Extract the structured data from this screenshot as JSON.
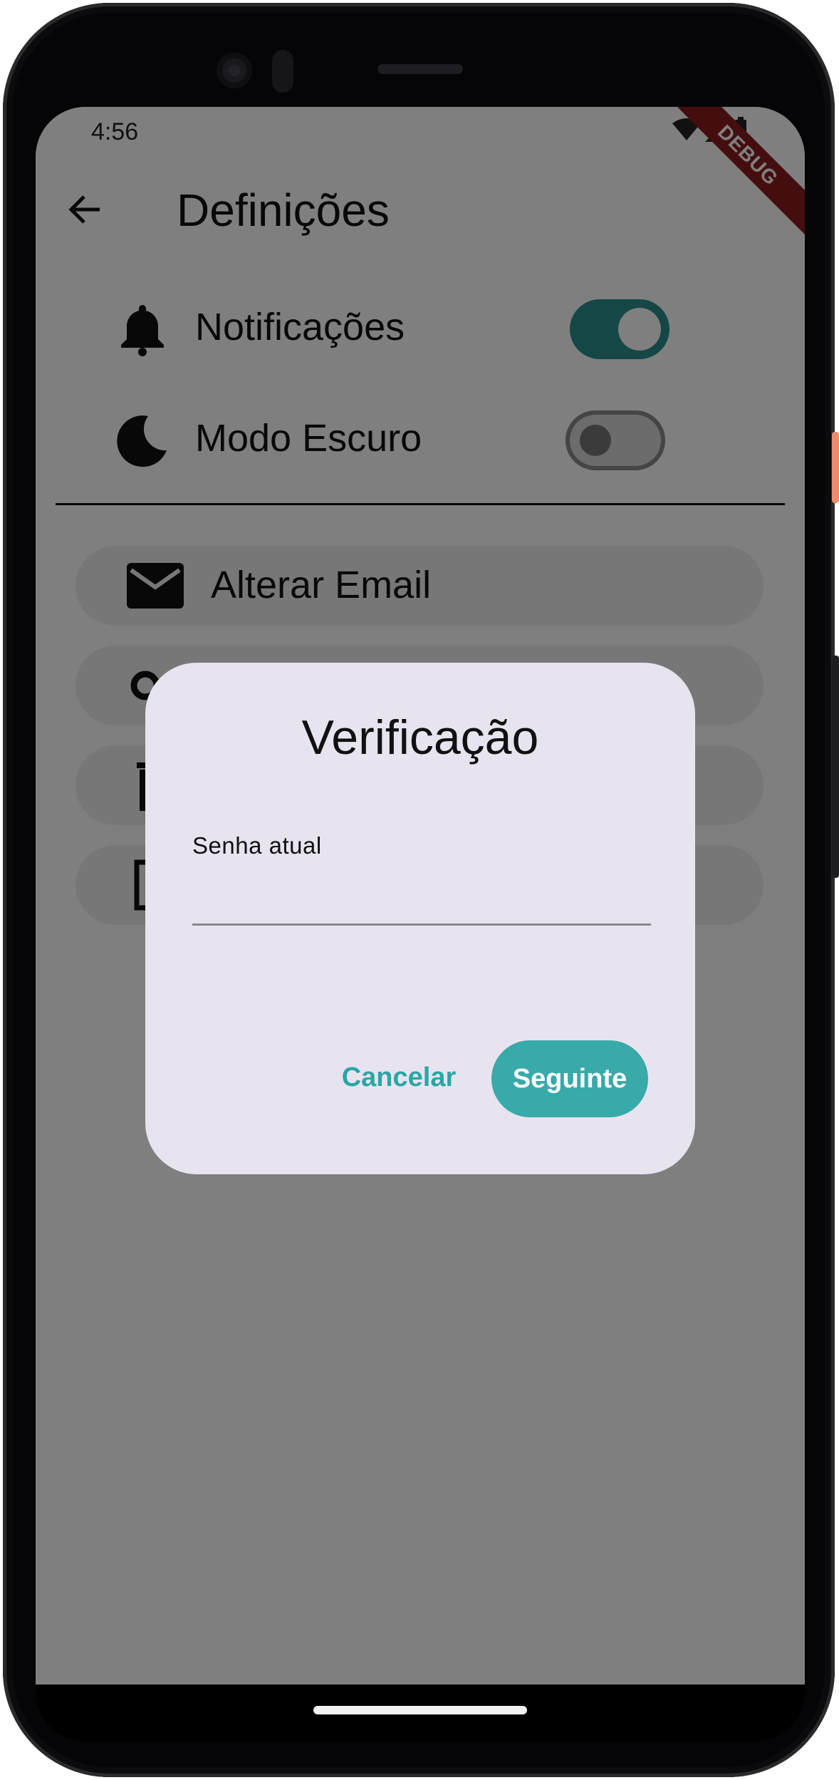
{
  "status_bar": {
    "time": "4:56"
  },
  "debug_banner": "DEBUG",
  "app_bar": {
    "title": "Definições"
  },
  "toggles": [
    {
      "label": "Notificações",
      "icon": "bell-icon",
      "on": true
    },
    {
      "label": "Modo Escuro",
      "icon": "moon-icon",
      "on": false
    }
  ],
  "actions": [
    {
      "label": "Alterar Email",
      "icon": "mail-icon"
    },
    {
      "label": "",
      "icon": "key-icon"
    },
    {
      "label": "",
      "icon": "trash-icon"
    },
    {
      "label": "",
      "icon": "logout-icon"
    }
  ],
  "dialog": {
    "title": "Verificação",
    "field_label": "Senha atual",
    "field_value": "",
    "cancel_label": "Cancelar",
    "next_label": "Seguinte"
  },
  "colors": {
    "accent": "#38aaa9",
    "switch_on": "#2a8f8f",
    "dialog_bg": "#e8e4ef",
    "debug_banner": "#8b1d1d"
  }
}
